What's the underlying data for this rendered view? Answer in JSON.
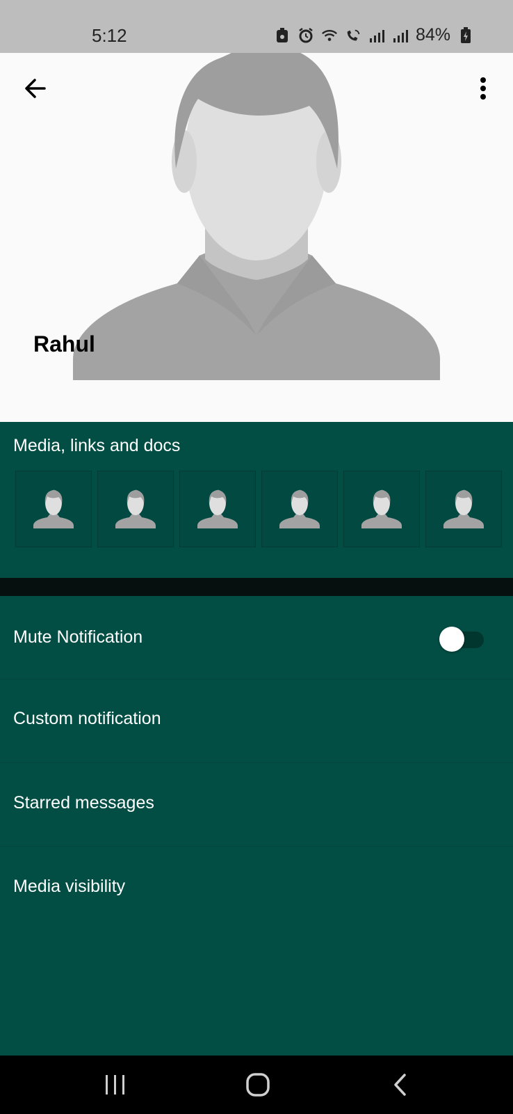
{
  "status_bar": {
    "time": "5:12",
    "battery": "84%",
    "icons": [
      "app-notification-icon",
      "alarm-icon",
      "wifi-icon",
      "wifi-calling-icon",
      "signal-roaming-icon",
      "signal-icon",
      "battery-charging-icon"
    ]
  },
  "header": {
    "contact_name": "Rahul",
    "back_icon": "arrow-left-icon",
    "menu_icon": "more-vertical-icon",
    "background": "#fafafa"
  },
  "media": {
    "title": "Media, links and docs",
    "thumbnails": [
      "avatar-placeholder",
      "avatar-placeholder",
      "avatar-placeholder",
      "avatar-placeholder",
      "avatar-placeholder",
      "avatar-placeholder"
    ]
  },
  "settings": {
    "mute_label": "Mute Notification",
    "mute_enabled": false,
    "custom_notification_label": "Custom notification",
    "starred_messages_label": "Starred messages",
    "media_visibility_label": "Media visibility"
  },
  "nav_bar": {
    "recents_icon": "recents-icon",
    "home_icon": "home-icon",
    "back_icon": "back-chevron-icon"
  },
  "colors": {
    "accent": "#024e44",
    "divider": "#06100f",
    "status_bar": "#bdbdbd"
  }
}
